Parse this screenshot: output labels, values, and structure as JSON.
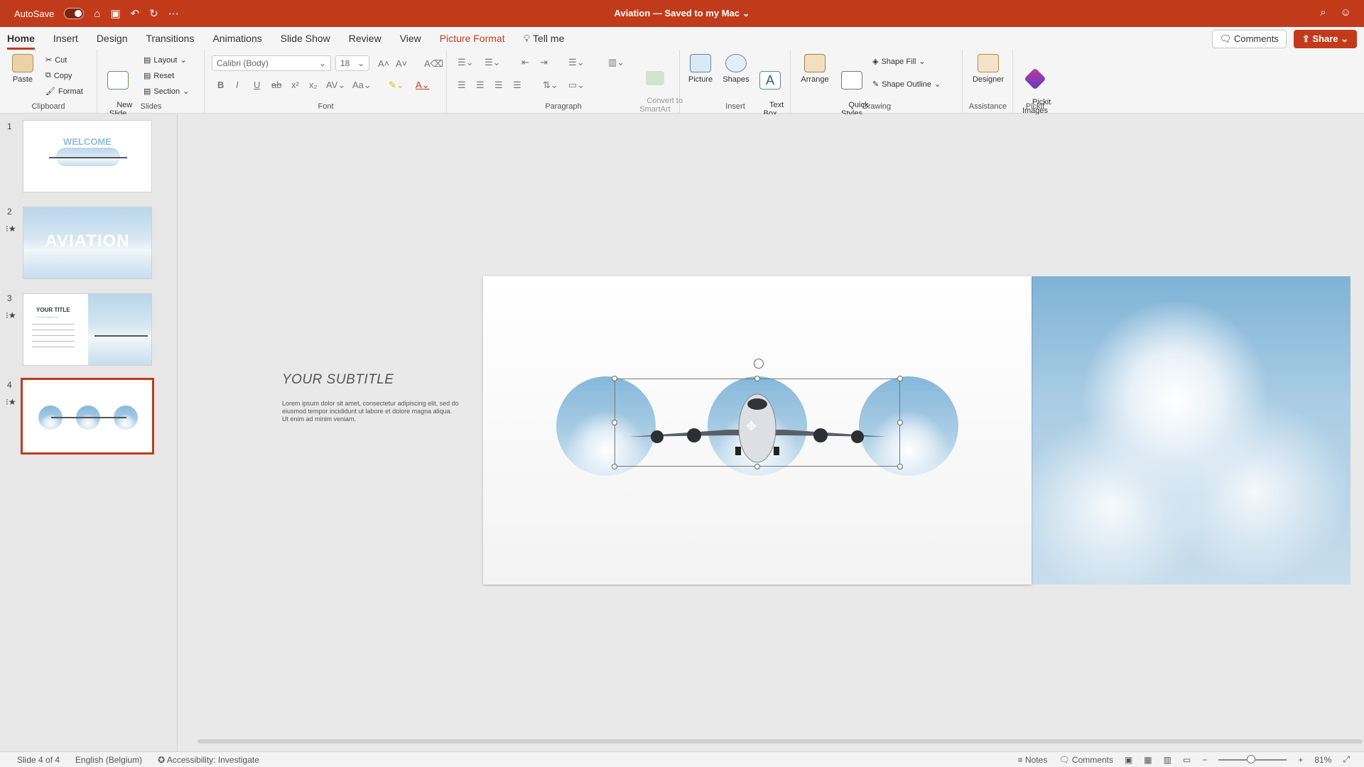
{
  "titlebar": {
    "autosave": "AutoSave",
    "doc_title": "Aviation — Saved to my Mac ⌄"
  },
  "menu": {
    "tabs": [
      "Home",
      "Insert",
      "Design",
      "Transitions",
      "Animations",
      "Slide Show",
      "Review",
      "View",
      "Picture Format",
      "Tell me"
    ],
    "comments": "Comments",
    "share": "Share"
  },
  "ribbon": {
    "clipboard": {
      "paste": "Paste",
      "cut": "Cut",
      "copy": "Copy",
      "format": "Format",
      "label": "Clipboard"
    },
    "slides": {
      "new_slide": "New\nSlide",
      "layout": "Layout",
      "reset": "Reset",
      "section": "Section",
      "label": "Slides"
    },
    "font": {
      "family": "Calibri (Body)",
      "size": "18",
      "label": "Font"
    },
    "paragraph": {
      "convert": "Convert to\nSmartArt",
      "label": "Paragraph"
    },
    "insert": {
      "picture": "Picture",
      "shapes": "Shapes",
      "textbox": "Text\nBox",
      "label": "Insert"
    },
    "drawing": {
      "arrange": "Arrange",
      "quick_styles": "Quick\nStyles",
      "shape_fill": "Shape Fill",
      "shape_outline": "Shape Outline",
      "label": "Drawing"
    },
    "assistance": {
      "designer": "Designer",
      "label": "Assistance"
    },
    "pickit": {
      "images": "Pickit\nImages",
      "label": "Pickit"
    }
  },
  "slides_pane": {
    "thumbs": [
      {
        "num": "1",
        "text": "WELCOME"
      },
      {
        "num": "2",
        "text": "AVIATION"
      },
      {
        "num": "3",
        "text": "YOUR TITLE",
        "sub": "YOUR SUBTITLE"
      },
      {
        "num": "4",
        "text": ""
      }
    ]
  },
  "slide": {
    "subtitle": "YOUR SUBTITLE",
    "body": "Lorem ipsum dolor sit amet, consectetur adipiscing elit, sed do eiusmod tempor incididunt ut labore et dolore magna aliqua. Ut enim ad minim veniam."
  },
  "status": {
    "slide": "Slide 4 of 4",
    "language": "English (Belgium)",
    "accessibility": "Accessibility: Investigate",
    "notes": "Notes",
    "comments": "Comments",
    "zoom": "81%"
  },
  "colors": {
    "accent": "#c13b1b"
  }
}
